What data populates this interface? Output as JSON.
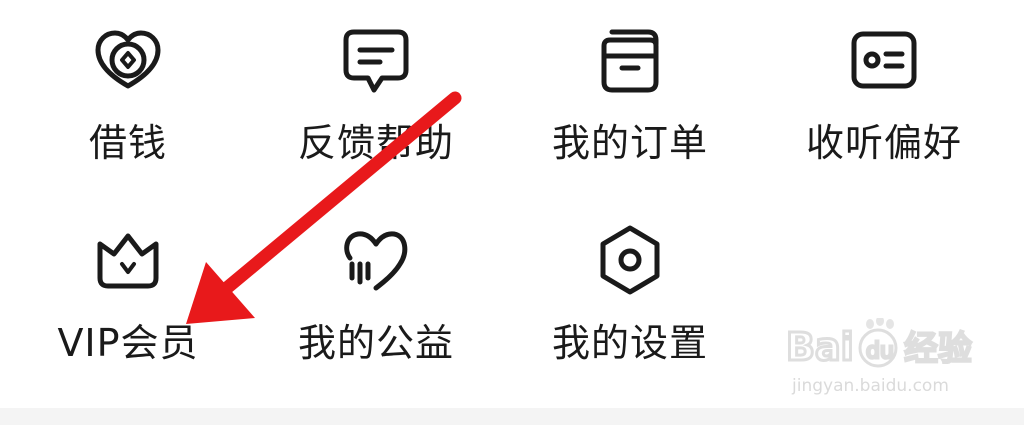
{
  "menu": {
    "items": [
      {
        "label": "借钱",
        "icon": "coin-heart-icon"
      },
      {
        "label": "反馈帮助",
        "icon": "feedback-chat-icon"
      },
      {
        "label": "我的订单",
        "icon": "orders-box-icon"
      },
      {
        "label": "收听偏好",
        "icon": "preference-card-icon"
      },
      {
        "label": "VIP会员",
        "icon": "crown-icon"
      },
      {
        "label": "我的公益",
        "icon": "charity-heart-icon"
      },
      {
        "label": "我的设置",
        "icon": "settings-hexagon-icon"
      }
    ]
  },
  "annotation": {
    "arrow_color": "#e8191b",
    "points_to": "VIP会员"
  },
  "watermark": {
    "logo_text": "Baidu经验",
    "url": "jingyan.baidu.com"
  }
}
